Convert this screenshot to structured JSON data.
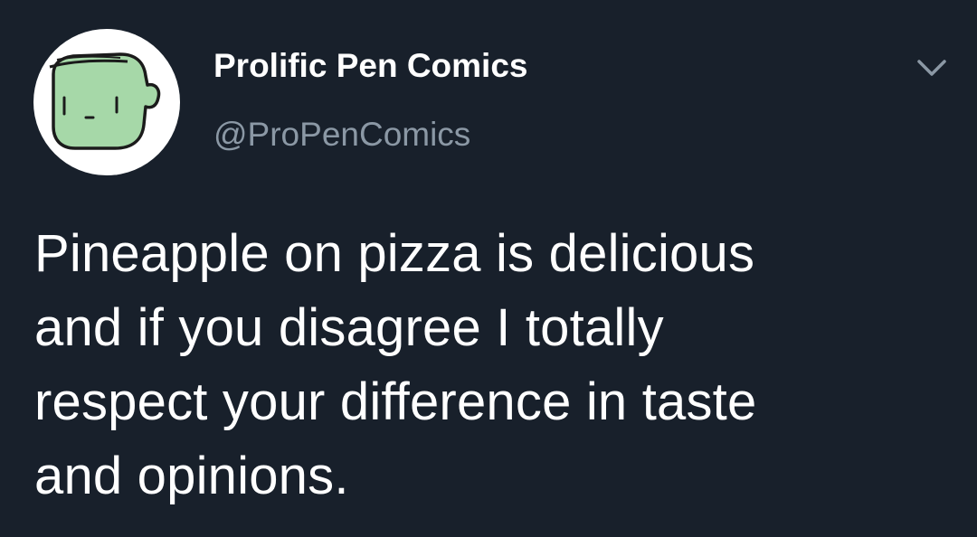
{
  "tweet": {
    "author": {
      "display_name": "Prolific Pen Comics",
      "handle": "@ProPenComics",
      "avatar_icon": "green-cartoon-face-avatar"
    },
    "menu_icon": "chevron-down-icon",
    "text": "Pineapple on pizza is delicious\nand if you disagree I totally\nrespect your difference in taste\nand opinions."
  },
  "colors": {
    "background": "#18202b",
    "text_primary": "#ffffff",
    "text_secondary": "#8b98a5",
    "avatar_face": "#a6d8a8"
  }
}
